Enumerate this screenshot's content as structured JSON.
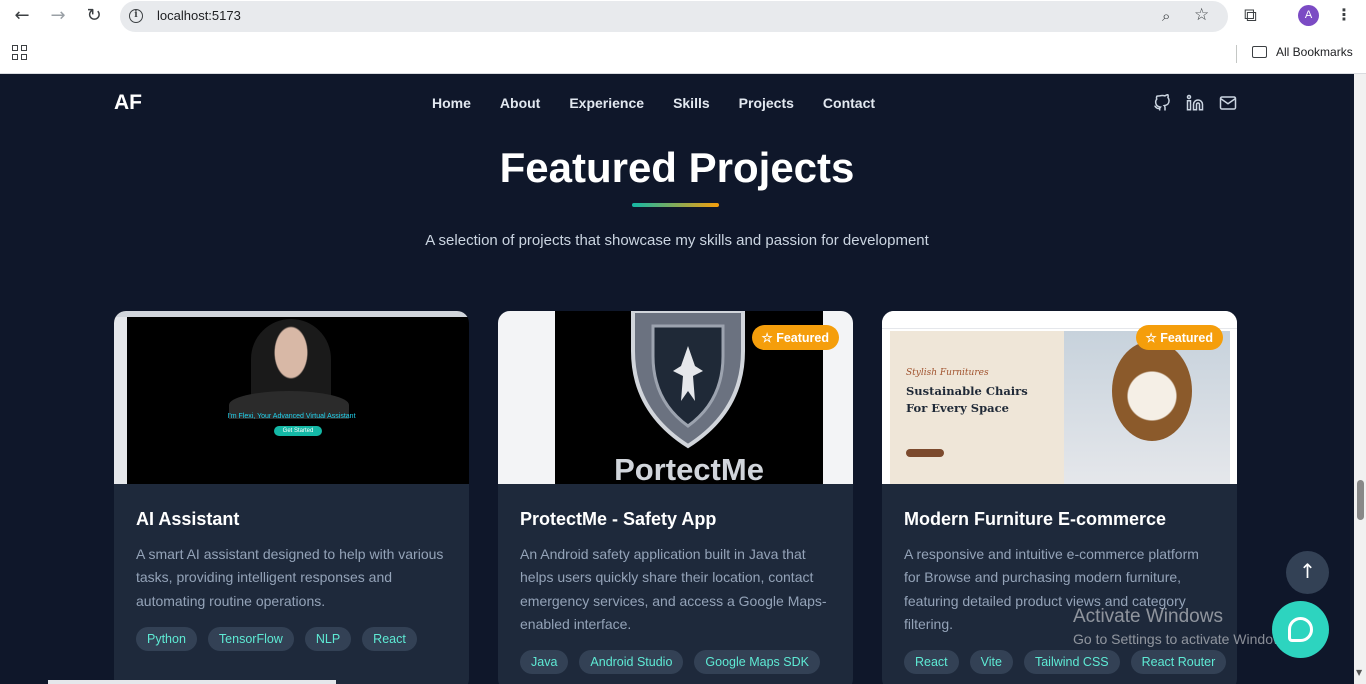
{
  "browser": {
    "url": "localhost:5173",
    "avatar_letter": "A",
    "bookmarks_label": "All Bookmarks"
  },
  "site": {
    "logo": "AF",
    "nav": [
      "Home",
      "About",
      "Experience",
      "Skills",
      "Projects",
      "Contact"
    ],
    "social_icons": [
      "github-icon",
      "linkedin-icon",
      "mail-icon"
    ]
  },
  "section": {
    "title": "Featured Projects",
    "subtitle": "A selection of projects that showcase my skills and passion for development"
  },
  "projects": [
    {
      "title": "AI Assistant",
      "description": "A smart AI assistant designed to help with various tasks, providing intelligent responses and automating routine operations.",
      "tags": [
        "Python",
        "TensorFlow",
        "NLP",
        "React"
      ],
      "featured": false,
      "thumb_text": "I'm Flexi, Your Advanced Virtual Assistant",
      "thumb_button": "Get Started"
    },
    {
      "title": "ProtectMe - Safety App",
      "description": "An Android safety application built in Java that helps users quickly share their location, contact emergency services, and access a Google Maps-enabled interface.",
      "tags": [
        "Java",
        "Android Studio",
        "Google Maps SDK"
      ],
      "featured": true,
      "featured_label": "Featured",
      "thumb_text": "PortectMe"
    },
    {
      "title": "Modern Furniture E-commerce",
      "description": "A responsive and intuitive e-commerce platform for Browse and purchasing modern furniture, featuring detailed product views and category filtering.",
      "tags": [
        "React",
        "Vite",
        "Tailwind CSS",
        "React Router"
      ],
      "featured": true,
      "featured_label": "Featured",
      "thumb_tagline": "Stylish Furnitures",
      "thumb_heading": "Sustainable Chairs For Every Space"
    }
  ],
  "watermark": {
    "line1": "Activate Windows",
    "line2": "Go to Settings to activate Windows."
  },
  "colors": {
    "page_bg": "#0f172a",
    "card_bg": "#1e293b",
    "accent_teal": "#2dd4bf",
    "accent_amber": "#f59e0b"
  }
}
